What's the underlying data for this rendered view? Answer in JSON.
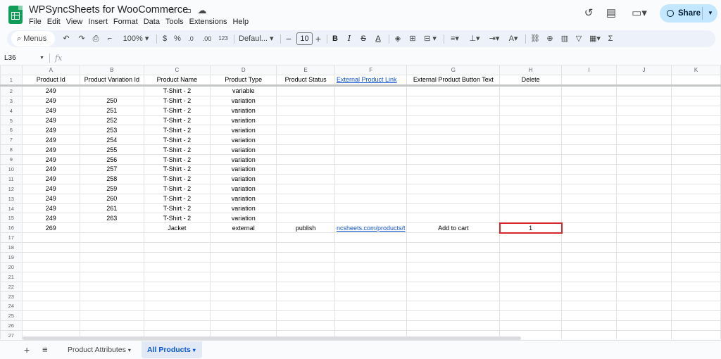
{
  "doc": {
    "title": "WPSyncSheets for WooCommerce"
  },
  "menu": [
    "File",
    "Edit",
    "View",
    "Insert",
    "Format",
    "Data",
    "Tools",
    "Extensions",
    "Help"
  ],
  "header": {
    "share_label": "Share"
  },
  "toolbar": {
    "menus_label": "Menus",
    "zoom": "100%",
    "currency": "$",
    "percent": "%",
    "dec_less": ".0",
    "dec_more": ".00",
    "number_format": "123",
    "font": "Defaul...",
    "font_size": "10"
  },
  "formula_bar": {
    "cell_ref": "L36",
    "fx": "fx"
  },
  "columns": [
    "A",
    "B",
    "C",
    "D",
    "E",
    "F",
    "G",
    "H",
    "I",
    "J",
    "K"
  ],
  "rows": [
    [
      "1",
      "Product Id",
      "Product Variation Id",
      "Product Name",
      "Product Type",
      "Product Status",
      "External Product Link",
      "External Product Button Text",
      "Delete",
      "",
      "",
      ""
    ],
    [
      "2",
      "249",
      "",
      "T-Shirt - 2",
      "variable",
      "",
      "",
      "",
      "",
      "",
      "",
      ""
    ],
    [
      "3",
      "249",
      "250",
      "T-Shirt - 2",
      "variation",
      "",
      "",
      "",
      "",
      "",
      "",
      ""
    ],
    [
      "4",
      "249",
      "251",
      "T-Shirt - 2",
      "variation",
      "",
      "",
      "",
      "",
      "",
      "",
      ""
    ],
    [
      "5",
      "249",
      "252",
      "T-Shirt - 2",
      "variation",
      "",
      "",
      "",
      "",
      "",
      "",
      ""
    ],
    [
      "6",
      "249",
      "253",
      "T-Shirt - 2",
      "variation",
      "",
      "",
      "",
      "",
      "",
      "",
      ""
    ],
    [
      "7",
      "249",
      "254",
      "T-Shirt - 2",
      "variation",
      "",
      "",
      "",
      "",
      "",
      "",
      ""
    ],
    [
      "8",
      "249",
      "255",
      "T-Shirt - 2",
      "variation",
      "",
      "",
      "",
      "",
      "",
      "",
      ""
    ],
    [
      "9",
      "249",
      "256",
      "T-Shirt - 2",
      "variation",
      "",
      "",
      "",
      "",
      "",
      "",
      ""
    ],
    [
      "10",
      "249",
      "257",
      "T-Shirt - 2",
      "variation",
      "",
      "",
      "",
      "",
      "",
      "",
      ""
    ],
    [
      "11",
      "249",
      "258",
      "T-Shirt - 2",
      "variation",
      "",
      "",
      "",
      "",
      "",
      "",
      ""
    ],
    [
      "12",
      "249",
      "259",
      "T-Shirt - 2",
      "variation",
      "",
      "",
      "",
      "",
      "",
      "",
      ""
    ],
    [
      "13",
      "249",
      "260",
      "T-Shirt - 2",
      "variation",
      "",
      "",
      "",
      "",
      "",
      "",
      ""
    ],
    [
      "14",
      "249",
      "261",
      "T-Shirt - 2",
      "variation",
      "",
      "",
      "",
      "",
      "",
      "",
      ""
    ],
    [
      "15",
      "249",
      "263",
      "T-Shirt - 2",
      "variation",
      "",
      "",
      "",
      "",
      "",
      "",
      ""
    ],
    [
      "16",
      "269",
      "",
      "Jacket",
      "external",
      "publish",
      "ncsheets.com/products/t",
      "Add to cart",
      "1",
      "",
      "",
      ""
    ],
    [
      "17",
      "",
      "",
      "",
      "",
      "",
      "",
      "",
      "",
      "",
      "",
      ""
    ],
    [
      "18",
      "",
      "",
      "",
      "",
      "",
      "",
      "",
      "",
      "",
      "",
      ""
    ],
    [
      "19",
      "",
      "",
      "",
      "",
      "",
      "",
      "",
      "",
      "",
      "",
      ""
    ],
    [
      "20",
      "",
      "",
      "",
      "",
      "",
      "",
      "",
      "",
      "",
      "",
      ""
    ],
    [
      "21",
      "",
      "",
      "",
      "",
      "",
      "",
      "",
      "",
      "",
      "",
      ""
    ],
    [
      "22",
      "",
      "",
      "",
      "",
      "",
      "",
      "",
      "",
      "",
      "",
      ""
    ],
    [
      "23",
      "",
      "",
      "",
      "",
      "",
      "",
      "",
      "",
      "",
      "",
      ""
    ],
    [
      "24",
      "",
      "",
      "",
      "",
      "",
      "",
      "",
      "",
      "",
      "",
      ""
    ],
    [
      "25",
      "",
      "",
      "",
      "",
      "",
      "",
      "",
      "",
      "",
      "",
      ""
    ],
    [
      "26",
      "",
      "",
      "",
      "",
      "",
      "",
      "",
      "",
      "",
      "",
      ""
    ],
    [
      "27",
      "",
      "",
      "",
      "",
      "",
      "",
      "",
      "",
      "",
      "",
      ""
    ]
  ],
  "sheet_tabs": [
    "Product Attributes",
    "All Products"
  ],
  "highlight": {
    "cell": "H16",
    "color": "#d9262c"
  }
}
